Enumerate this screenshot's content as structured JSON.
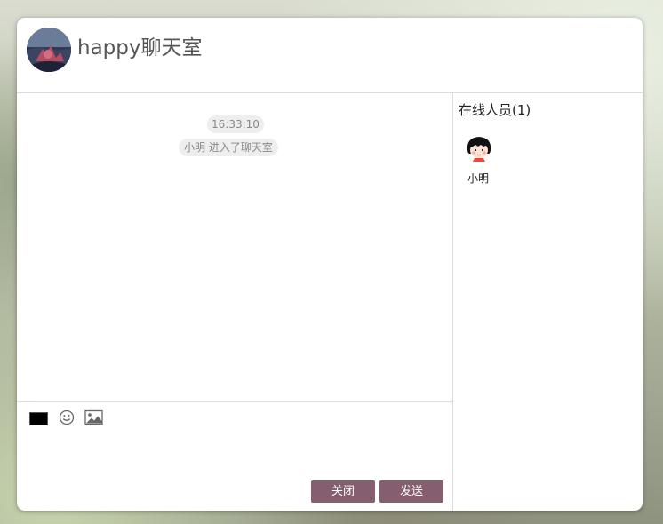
{
  "header": {
    "room_title": "happy聊天室"
  },
  "messages": {
    "time": "16:33:10",
    "notice": "小明 进入了聊天室"
  },
  "toolbar": {
    "font_color": "#000000",
    "emoji_icon": "smiley-face",
    "image_icon": "picture"
  },
  "actions": {
    "close_label": "关闭",
    "send_label": "发送",
    "button_color": "#855f70"
  },
  "online": {
    "title": "在线人员(1)",
    "users": [
      {
        "name": "小明",
        "avatar_icon": "cartoon-girl-avatar"
      }
    ]
  }
}
